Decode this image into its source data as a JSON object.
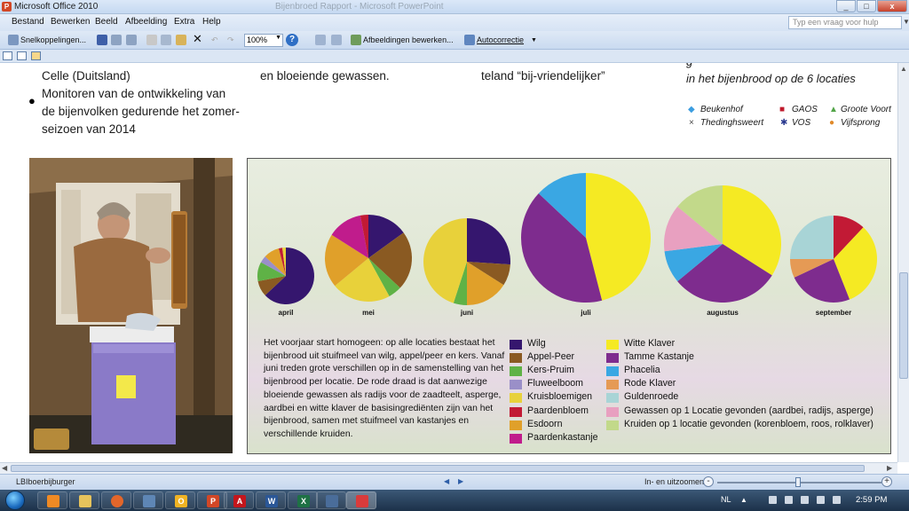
{
  "window": {
    "title": "Microsoft Office 2010",
    "doc_title": "Bijenbroed Rapport - Microsoft PowerPoint"
  },
  "menu": {
    "items": [
      "Bestand",
      "Bewerken",
      "Beeld",
      "Afbeelding",
      "Extra",
      "Help"
    ],
    "help_placeholder": "Typ een vraag voor hulp"
  },
  "toolbar": {
    "shortcuts_label": "Snelkoppelingen...",
    "zoom_value": "100%",
    "edit_images_label": "Afbeeldingen bewerken...",
    "autocorrect_label": "Autocorrectie"
  },
  "slide": {
    "col1_line0": "Celle (Duitsland)",
    "col1_bullet": "Monitoren van de ontwikkeling van",
    "col1_line2": "de bijenvolken gedurende het zomer-",
    "col1_line3": "seizoen van 2014",
    "col2_line": "en bloeiende gewassen.",
    "col3_line": "teland “bij-vriendelijker”",
    "col4_heading": "in het bijenbrood op de 6 locaties",
    "col4_heading_clip": "g",
    "locations": [
      {
        "name": "Beukenhof",
        "symbol": "◆",
        "color": "#3b9de0"
      },
      {
        "name": "GAOS",
        "symbol": "■",
        "color": "#c01a2c"
      },
      {
        "name": "Groote Voort",
        "symbol": "▲",
        "color": "#52a447"
      },
      {
        "name": "Thedinghsweert",
        "symbol": "×",
        "color": "#444444"
      },
      {
        "name": "VOS",
        "symbol": "✱",
        "color": "#2b3a8f"
      },
      {
        "name": "Vijfsprong",
        "symbol": "●",
        "color": "#e08a2a"
      }
    ],
    "description": "Het voorjaar start homogeen: op alle locaties bestaat het bijenbrood uit stuifmeel van wilg, appel/peer en kers. Vanaf juni treden grote verschillen op in de samenstelling van het bijenbrood per locatie. De rode draad is dat aanwezige bloeiende gewassen als radijs voor de zaadteelt, asperge, aardbei en witte klaver de basisingrediënten zijn van het bijenbrood, samen met stuifmeel van  kastanjes en verschillende kruiden."
  },
  "chart_data": {
    "type": "pie",
    "categories": [
      {
        "name": "Wilg",
        "color": "#35166e"
      },
      {
        "name": "Appel-Peer",
        "color": "#8a5a22"
      },
      {
        "name": "Kers-Pruim",
        "color": "#5fb246"
      },
      {
        "name": "Fluweelboom",
        "color": "#9a8fc8"
      },
      {
        "name": "Kruisbloemigen",
        "color": "#e8d13a"
      },
      {
        "name": "Paardenbloem",
        "color": "#c21a35"
      },
      {
        "name": "Esdoorn",
        "color": "#e0a02a"
      },
      {
        "name": "Paardenkastanje",
        "color": "#c01c8c"
      },
      {
        "name": "Witte Klaver",
        "color": "#f5ea23"
      },
      {
        "name": "Tamme Kastanje",
        "color": "#7e2c8e"
      },
      {
        "name": "Phacelia",
        "color": "#3aa7e3"
      },
      {
        "name": "Rode Klaver",
        "color": "#e59a55"
      },
      {
        "name": "Guldenroede",
        "color": "#a8d4d6"
      },
      {
        "name": "Gewassen op 1 Locatie gevonden (aardbei, radijs, asperge)",
        "color": "#e8a0c0"
      },
      {
        "name": "Kruiden op 1 locatie gevonden (korenbloem, roos, rolklaver)",
        "color": "#c2d98a"
      }
    ],
    "pies": [
      {
        "month": "april",
        "slices": {
          "Wilg": 63,
          "Appel-Peer": 9,
          "Kers-Pruim": 11,
          "Fluweelboom": 4,
          "Esdoorn": 9,
          "Paardenbloem": 2,
          "Kruisbloemigen": 2
        }
      },
      {
        "month": "mei",
        "slices": {
          "Wilg": 15,
          "Appel-Peer": 22,
          "Kers-Pruim": 5,
          "Kruisbloemigen": 22,
          "Esdoorn": 20,
          "Paardenkastanje": 13,
          "Paardenbloem": 3
        }
      },
      {
        "month": "juni",
        "slices": {
          "Wilg": 26,
          "Appel-Peer": 8,
          "Esdoorn": 16,
          "Kers-Pruim": 5,
          "Kruisbloemigen": 45
        }
      },
      {
        "month": "juli",
        "slices": {
          "Witte Klaver": 46,
          "Tamme Kastanje": 41,
          "Phacelia": 13
        }
      },
      {
        "month": "augustus",
        "slices": {
          "Witte Klaver": 34,
          "Tamme Kastanje": 30,
          "Phacelia": 9,
          "Gewassen op 1 Locatie gevonden (aardbei, radijs, asperge)": 13,
          "Kruiden op 1 locatie gevonden (korenbloem, roos, rolklaver)": 14
        }
      },
      {
        "month": "september",
        "slices": {
          "Paardenbloem": 12,
          "Witte Klaver": 32,
          "Tamme Kastanje": 24,
          "Rode Klaver": 7,
          "Guldenroede": 25
        }
      }
    ]
  },
  "status": {
    "file_name": "LBIboerbijburger",
    "zoom_label": "In- en uitzoomen:"
  },
  "taskbar": {
    "language": "NL",
    "time": "2:59 PM",
    "apps": [
      "explorer",
      "firefox",
      "network",
      "outlook",
      "powerpoint",
      "acrobat",
      "word",
      "excel",
      "tool",
      "office"
    ]
  }
}
